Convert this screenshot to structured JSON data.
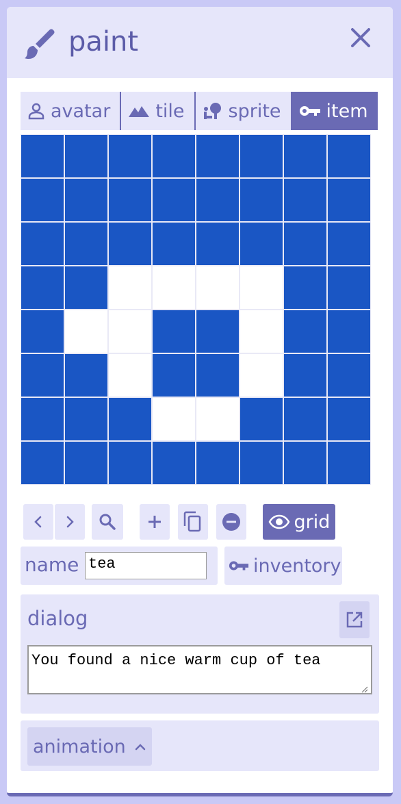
{
  "window": {
    "title": "paint",
    "title_icon": "paintbrush-icon",
    "close_icon": "close-icon"
  },
  "tabs": [
    {
      "label": "avatar",
      "icon": "person-icon",
      "active": false
    },
    {
      "label": "tile",
      "icon": "mountain-icon",
      "active": false
    },
    {
      "label": "sprite",
      "icon": "sprite-icon",
      "active": false
    },
    {
      "label": "item",
      "icon": "key-icon",
      "active": true
    }
  ],
  "canvas": {
    "grid_size": 8,
    "fill_color": "#1a56c4",
    "empty_color": "#ffffff",
    "gridline_color": "#e9e9f6",
    "pixels": [
      [
        1,
        1,
        1,
        1,
        1,
        1,
        1,
        1
      ],
      [
        1,
        1,
        1,
        1,
        1,
        1,
        1,
        1
      ],
      [
        1,
        1,
        1,
        1,
        1,
        1,
        1,
        1
      ],
      [
        1,
        1,
        0,
        0,
        0,
        0,
        1,
        1
      ],
      [
        1,
        0,
        0,
        1,
        1,
        0,
        1,
        1
      ],
      [
        1,
        1,
        0,
        1,
        1,
        0,
        1,
        1
      ],
      [
        1,
        1,
        1,
        0,
        0,
        1,
        1,
        1
      ],
      [
        1,
        1,
        1,
        1,
        1,
        1,
        1,
        1
      ]
    ]
  },
  "toolbar": {
    "prev_icon": "chevron-left-icon",
    "next_icon": "chevron-right-icon",
    "find_icon": "search-icon",
    "add_icon": "plus-icon",
    "duplicate_icon": "duplicate-icon",
    "delete_icon": "minus-circle-icon",
    "grid_label": "grid",
    "grid_icon": "eye-icon"
  },
  "name": {
    "label": "name",
    "value": "tea"
  },
  "inventory": {
    "label": "inventory",
    "icon": "key-icon"
  },
  "dialog": {
    "label": "dialog",
    "text": "You found a nice warm cup of tea",
    "open_icon": "open-external-icon"
  },
  "animation": {
    "label": "animation",
    "icon": "chevron-up-icon"
  },
  "colors": {
    "accent": "#6a6ab4",
    "panel_bg": "#e6e6fa",
    "background": "#c9c9f6"
  }
}
